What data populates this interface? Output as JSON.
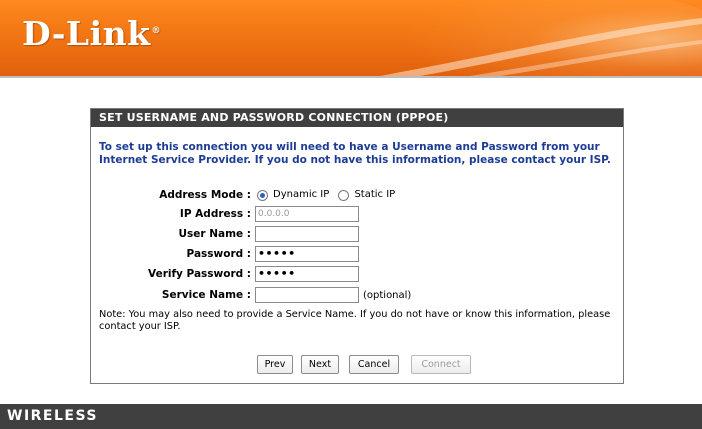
{
  "header": {
    "logo_text": "D-Link",
    "logo_mark": "®"
  },
  "panel": {
    "title": "SET USERNAME AND PASSWORD CONNECTION (PPPOE)",
    "intro": "To set up this connection you will need to have a Username and Password from your Internet Service Provider. If you do not have this information, please contact your ISP.",
    "address_mode": {
      "label": "Address Mode :",
      "options": [
        {
          "label": "Dynamic IP",
          "checked": true
        },
        {
          "label": "Static IP",
          "checked": false
        }
      ]
    },
    "ip_address": {
      "label": "IP Address :",
      "placeholder": "0.0.0.0"
    },
    "user_name": {
      "label": "User Name :",
      "value": ""
    },
    "password": {
      "label": "Password :",
      "value": "•••••"
    },
    "verify_password": {
      "label": "Verify Password :",
      "value": "•••••"
    },
    "service_name": {
      "label": "Service Name :",
      "value": "",
      "hint": "(optional)"
    },
    "note": "Note: You may also need to provide a Service Name. If you do not have or know this information, please contact your ISP.",
    "buttons": {
      "prev": "Prev",
      "next": "Next",
      "cancel": "Cancel",
      "connect": "Connect"
    }
  },
  "footer": {
    "text": "WIRELESS"
  },
  "colors": {
    "brand_orange": "#f47a15",
    "title_bar": "#404040",
    "intro_text": "#1d3c94"
  }
}
